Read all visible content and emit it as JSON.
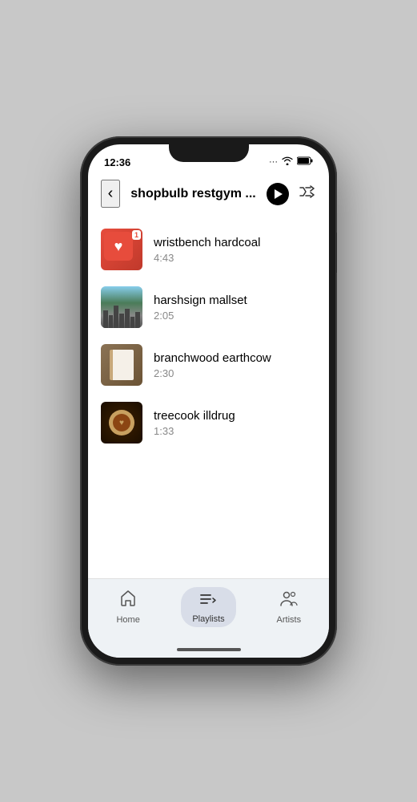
{
  "status": {
    "time": "12:36",
    "signal": "···",
    "wifi": "WiFi",
    "battery": "Battery"
  },
  "header": {
    "title": "shopbulb restgym ...",
    "back_label": "‹",
    "play_label": "Play",
    "shuffle_label": "Shuffle"
  },
  "tracks": [
    {
      "id": 1,
      "name": "wristbench hardcoal",
      "duration": "4:43",
      "thumb_type": "heart"
    },
    {
      "id": 2,
      "name": "harshsign mallset",
      "duration": "2:05",
      "thumb_type": "city"
    },
    {
      "id": 3,
      "name": "branchwood earthcow",
      "duration": "2:30",
      "thumb_type": "notebook"
    },
    {
      "id": 4,
      "name": "treecook illdrug",
      "duration": "1:33",
      "thumb_type": "coffee"
    }
  ],
  "nav": {
    "items": [
      {
        "id": "home",
        "label": "Home",
        "icon": "home",
        "active": false
      },
      {
        "id": "playlists",
        "label": "Playlists",
        "icon": "playlists",
        "active": true
      },
      {
        "id": "artists",
        "label": "Artists",
        "icon": "artists",
        "active": false
      }
    ]
  }
}
